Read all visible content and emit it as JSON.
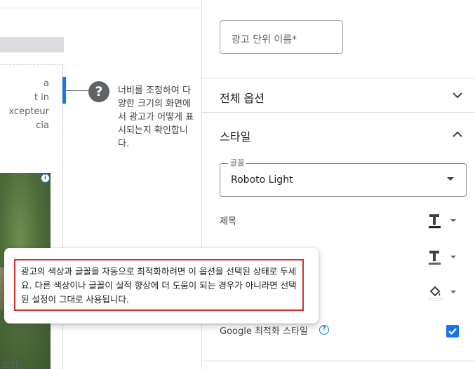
{
  "preview": {
    "text_lines": [
      "a",
      "t in",
      "xcepteur",
      "cia"
    ],
    "bottom_text": "까지",
    "adchoices_glyph": "i",
    "help_glyph": "?",
    "help_text": "너비를 조정하여 다양한 크기의 화면에서 광고가 어떻게 표시되는지 확인합니다."
  },
  "panel": {
    "ad_unit_name_placeholder": "광고 단위 이름*",
    "sections": {
      "global_options": "전체 옵션",
      "style": "스타일"
    },
    "font": {
      "label": "글꼴",
      "value": "Roboto Light"
    },
    "rows": {
      "title": "제목"
    },
    "google_optimize": {
      "label": "Google 최적화 스타일",
      "help_glyph": "?",
      "checked": true
    }
  },
  "tooltip": {
    "text": "광고의 색상과 글꼴을 자동으로 최적화하려면 이 옵션을 선택된 상태로 두세요. 다른 색상이나 글꼴이 실적 향상에 더 도움이 되는 경우가 아니라면 선택된 설정이 그대로 사용됩니다."
  },
  "colors": {
    "accent": "#1a73e8",
    "highlight_border": "#d32f2f",
    "title_underline": "#202124",
    "text_underline": "#5f6368",
    "fill_color": "#ffffff"
  },
  "icons": {
    "section_collapsed": "chevron-down-icon",
    "section_expanded": "chevron-up-icon",
    "help": "help-icon",
    "text_color": "text-color-icon",
    "background_color": "paint-bucket-icon",
    "checkbox": "check-icon"
  }
}
